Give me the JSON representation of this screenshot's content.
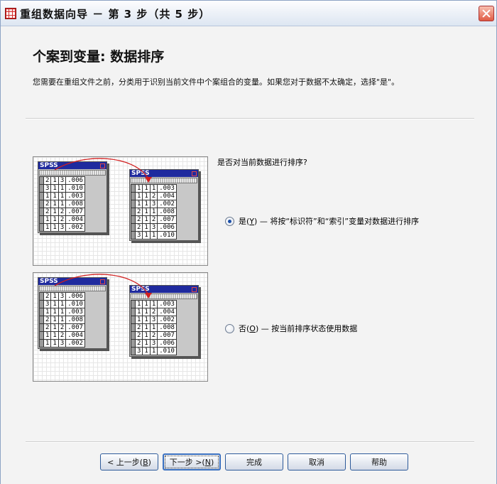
{
  "window": {
    "title": "重组数据向导 － 第 3 步（共 5 步）"
  },
  "page": {
    "heading": "个案到变量: 数据排序",
    "description": "您需要在重组文件之前，分类用于识别当前文件中个案组合的变量。如果您对于数据不太确定，选择\"是\"。",
    "question": "是否对当前数据进行排序?"
  },
  "options": [
    {
      "prefix": "是(",
      "mnemonic": "Y",
      "suffix": ") — 将按“标识符”和“索引”变量对数据进行排序",
      "checked": true
    },
    {
      "prefix": "否(",
      "mnemonic": "O",
      "suffix": ") — 按当前排序状态使用数据",
      "checked": false
    }
  ],
  "illustrations": [
    {
      "left": {
        "label": "SPSS",
        "rows": [
          [
            "2",
            "1",
            "3",
            ".006"
          ],
          [
            "3",
            "1",
            "1",
            ".010"
          ],
          [
            "1",
            "1",
            "1",
            ".003"
          ],
          [
            "2",
            "1",
            "1",
            ".008"
          ],
          [
            "2",
            "1",
            "2",
            ".007"
          ],
          [
            "1",
            "1",
            "2",
            ".004"
          ],
          [
            "1",
            "1",
            "3",
            ".002"
          ]
        ]
      },
      "right": {
        "label": "SPSS",
        "rows": [
          [
            "1",
            "1",
            "1",
            ".003"
          ],
          [
            "1",
            "1",
            "2",
            ".004"
          ],
          [
            "1",
            "1",
            "3",
            ".002"
          ],
          [
            "2",
            "1",
            "1",
            ".008"
          ],
          [
            "2",
            "1",
            "2",
            ".007"
          ],
          [
            "2",
            "1",
            "3",
            ".006"
          ],
          [
            "3",
            "1",
            "1",
            ".010"
          ]
        ]
      }
    },
    {
      "left": {
        "label": "SPSS",
        "rows": [
          [
            "2",
            "1",
            "3",
            ".006"
          ],
          [
            "3",
            "1",
            "1",
            ".010"
          ],
          [
            "1",
            "1",
            "1",
            ".003"
          ],
          [
            "2",
            "1",
            "1",
            ".008"
          ],
          [
            "2",
            "1",
            "2",
            ".007"
          ],
          [
            "1",
            "1",
            "2",
            ".004"
          ],
          [
            "1",
            "1",
            "3",
            ".002"
          ]
        ]
      },
      "right": {
        "label": "SPSS",
        "rows": [
          [
            "1",
            "1",
            "1",
            ".003"
          ],
          [
            "1",
            "1",
            "2",
            ".004"
          ],
          [
            "1",
            "1",
            "3",
            ".002"
          ],
          [
            "2",
            "1",
            "1",
            ".008"
          ],
          [
            "2",
            "1",
            "2",
            ".007"
          ],
          [
            "2",
            "1",
            "3",
            ".006"
          ],
          [
            "3",
            "1",
            "1",
            ".010"
          ]
        ]
      }
    }
  ],
  "buttons": {
    "back": {
      "prefix": "< 上一步(",
      "mnemonic": "B",
      "suffix": ")"
    },
    "next": {
      "prefix": "下一步 >(",
      "mnemonic": "N",
      "suffix": ")"
    },
    "finish": "完成",
    "cancel": "取消",
    "help": "帮助"
  },
  "colors": {
    "title_bar": "#e7edf6",
    "sheet_header": "#1f2a9e",
    "arrow": "#d21f1f",
    "radio_dot": "#1b4fa8"
  }
}
